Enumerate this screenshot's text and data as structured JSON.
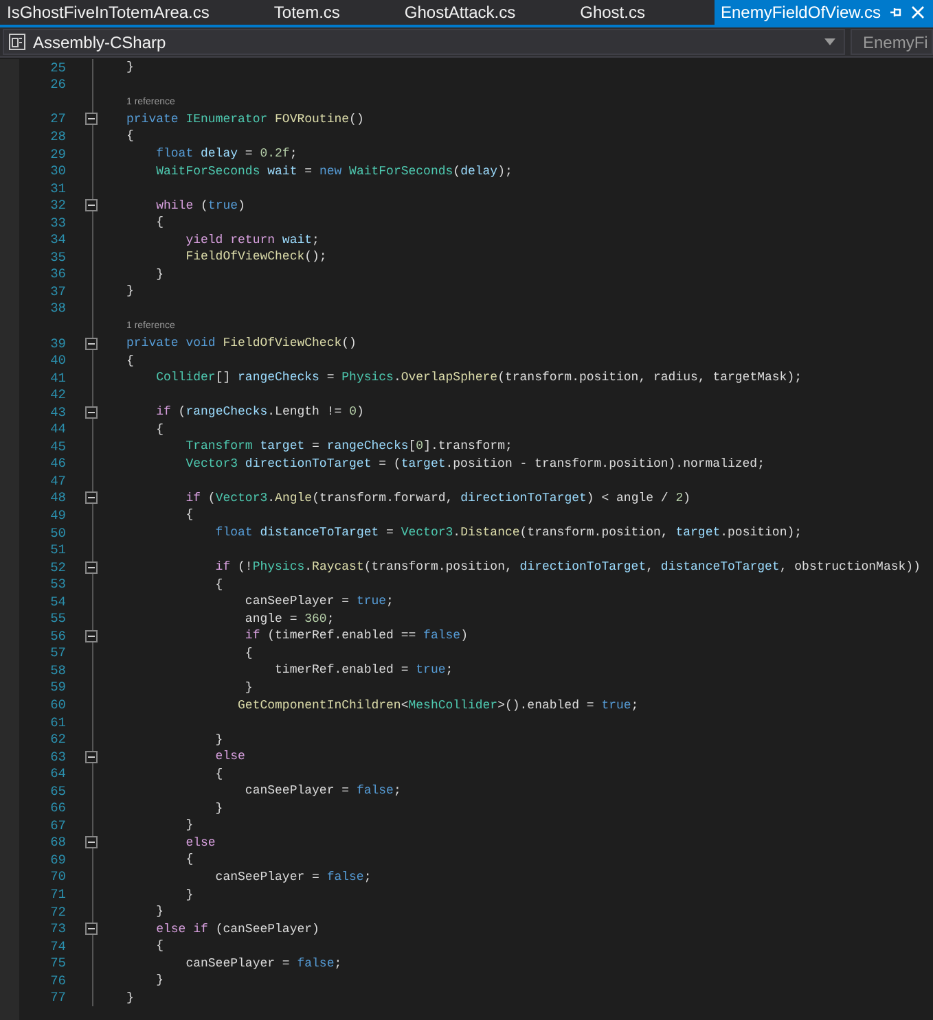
{
  "tabs": [
    {
      "label": "IsGhostFiveInTotemArea.cs",
      "selected": false
    },
    {
      "label": "Totem.cs",
      "selected": false
    },
    {
      "label": "GhostAttack.cs",
      "selected": false
    },
    {
      "label": "Ghost.cs",
      "selected": false
    },
    {
      "label": "EnemyFieldOfView.cs",
      "selected": true
    }
  ],
  "navigation_bar": {
    "project": "Assembly-CSharp",
    "class": "EnemyFi"
  },
  "lines": [
    {
      "kind": "code",
      "number": "25",
      "collapsible": false,
      "tokens": [
        {
          "kind": "plain",
          "text": "}"
        }
      ]
    },
    {
      "kind": "code",
      "number": "26",
      "collapsible": false
    },
    {
      "kind": "codelens",
      "text": "1 reference"
    },
    {
      "kind": "code",
      "number": "27",
      "collapsible": true,
      "tokens": [
        {
          "kind": "keyword",
          "text": "private"
        },
        {
          "kind": "type",
          "text": " IEnumerator"
        },
        {
          "kind": "method",
          "text": " FOVRoutine"
        },
        {
          "kind": "plain",
          "text": "()"
        }
      ]
    },
    {
      "kind": "code",
      "number": "28",
      "collapsible": false,
      "tokens": [
        {
          "kind": "plain",
          "text": "{"
        }
      ]
    },
    {
      "kind": "code",
      "number": "29",
      "collapsible": false,
      "tokens": [
        {
          "kind": "keyword",
          "text": "    float"
        },
        {
          "kind": "local",
          "text": " delay"
        },
        {
          "kind": "plain",
          "text": " = "
        },
        {
          "kind": "number",
          "text": "0.2f"
        },
        {
          "kind": "plain",
          "text": ";"
        }
      ]
    },
    {
      "kind": "code",
      "number": "30",
      "collapsible": false,
      "tokens": [
        {
          "kind": "type",
          "text": "    WaitForSeconds"
        },
        {
          "kind": "local",
          "text": " wait"
        },
        {
          "kind": "plain",
          "text": " = "
        },
        {
          "kind": "keyword",
          "text": "new"
        },
        {
          "kind": "type",
          "text": " WaitForSeconds"
        },
        {
          "kind": "plain",
          "text": "("
        },
        {
          "kind": "local",
          "text": "delay"
        },
        {
          "kind": "plain",
          "text": ");"
        }
      ]
    },
    {
      "kind": "code",
      "number": "31",
      "collapsible": false
    },
    {
      "kind": "code",
      "number": "32",
      "collapsible": true,
      "tokens": [
        {
          "kind": "control",
          "text": "    while"
        },
        {
          "kind": "plain",
          "text": " ("
        },
        {
          "kind": "keyword",
          "text": "true"
        },
        {
          "kind": "plain",
          "text": ")"
        }
      ]
    },
    {
      "kind": "code",
      "number": "33",
      "collapsible": false,
      "tokens": [
        {
          "kind": "plain",
          "text": "    {"
        }
      ]
    },
    {
      "kind": "code",
      "number": "34",
      "collapsible": false,
      "tokens": [
        {
          "kind": "control",
          "text": "        yield return"
        },
        {
          "kind": "local",
          "text": " wait"
        },
        {
          "kind": "plain",
          "text": ";"
        }
      ]
    },
    {
      "kind": "code",
      "number": "35",
      "collapsible": false,
      "tokens": [
        {
          "kind": "method",
          "text": "        FieldOfViewCheck"
        },
        {
          "kind": "plain",
          "text": "();"
        }
      ]
    },
    {
      "kind": "code",
      "number": "36",
      "collapsible": false,
      "tokens": [
        {
          "kind": "plain",
          "text": "    }"
        }
      ]
    },
    {
      "kind": "code",
      "number": "37",
      "collapsible": false,
      "tokens": [
        {
          "kind": "plain",
          "text": "}"
        }
      ]
    },
    {
      "kind": "code",
      "number": "38",
      "collapsible": false
    },
    {
      "kind": "codelens",
      "text": "1 reference"
    },
    {
      "kind": "code",
      "number": "39",
      "collapsible": true,
      "tokens": [
        {
          "kind": "keyword",
          "text": "private void"
        },
        {
          "kind": "method",
          "text": " FieldOfViewCheck"
        },
        {
          "kind": "plain",
          "text": "()"
        }
      ]
    },
    {
      "kind": "code",
      "number": "40",
      "collapsible": false,
      "tokens": [
        {
          "kind": "plain",
          "text": "{"
        }
      ]
    },
    {
      "kind": "code",
      "number": "41",
      "collapsible": false,
      "tokens": [
        {
          "kind": "type",
          "text": "    Collider"
        },
        {
          "kind": "plain",
          "text": "[] "
        },
        {
          "kind": "local",
          "text": "rangeChecks"
        },
        {
          "kind": "plain",
          "text": " = "
        },
        {
          "kind": "type",
          "text": "Physics"
        },
        {
          "kind": "plain",
          "text": "."
        },
        {
          "kind": "method",
          "text": "OverlapSphere"
        },
        {
          "kind": "plain",
          "text": "(transform.position, radius, targetMask);"
        }
      ]
    },
    {
      "kind": "code",
      "number": "42",
      "collapsible": false
    },
    {
      "kind": "code",
      "number": "43",
      "collapsible": true,
      "tokens": [
        {
          "kind": "control",
          "text": "    if"
        },
        {
          "kind": "plain",
          "text": " ("
        },
        {
          "kind": "local",
          "text": "rangeChecks"
        },
        {
          "kind": "plain",
          "text": ".Length != "
        },
        {
          "kind": "number",
          "text": "0"
        },
        {
          "kind": "plain",
          "text": ")"
        }
      ]
    },
    {
      "kind": "code",
      "number": "44",
      "collapsible": false,
      "tokens": [
        {
          "kind": "plain",
          "text": "    {"
        }
      ]
    },
    {
      "kind": "code",
      "number": "45",
      "collapsible": false,
      "tokens": [
        {
          "kind": "type",
          "text": "        Transform"
        },
        {
          "kind": "local",
          "text": " target"
        },
        {
          "kind": "plain",
          "text": " = "
        },
        {
          "kind": "local",
          "text": "rangeChecks"
        },
        {
          "kind": "plain",
          "text": "["
        },
        {
          "kind": "number",
          "text": "0"
        },
        {
          "kind": "plain",
          "text": "].transform;"
        }
      ]
    },
    {
      "kind": "code",
      "number": "46",
      "collapsible": false,
      "tokens": [
        {
          "kind": "type",
          "text": "        Vector3"
        },
        {
          "kind": "local",
          "text": " directionToTarget"
        },
        {
          "kind": "plain",
          "text": " = ("
        },
        {
          "kind": "local",
          "text": "target"
        },
        {
          "kind": "plain",
          "text": ".position - transform.position).normalized;"
        }
      ]
    },
    {
      "kind": "code",
      "number": "47",
      "collapsible": false
    },
    {
      "kind": "code",
      "number": "48",
      "collapsible": true,
      "tokens": [
        {
          "kind": "control",
          "text": "        if"
        },
        {
          "kind": "plain",
          "text": " ("
        },
        {
          "kind": "type",
          "text": "Vector3"
        },
        {
          "kind": "plain",
          "text": "."
        },
        {
          "kind": "method",
          "text": "Angle"
        },
        {
          "kind": "plain",
          "text": "(transform.forward, "
        },
        {
          "kind": "local",
          "text": "directionToTarget"
        },
        {
          "kind": "plain",
          "text": ") < angle / "
        },
        {
          "kind": "number",
          "text": "2"
        },
        {
          "kind": "plain",
          "text": ")"
        }
      ]
    },
    {
      "kind": "code",
      "number": "49",
      "collapsible": false,
      "tokens": [
        {
          "kind": "plain",
          "text": "        {"
        }
      ]
    },
    {
      "kind": "code",
      "number": "50",
      "collapsible": false,
      "tokens": [
        {
          "kind": "keyword",
          "text": "            float"
        },
        {
          "kind": "local",
          "text": " distanceToTarget"
        },
        {
          "kind": "plain",
          "text": " = "
        },
        {
          "kind": "type",
          "text": "Vector3"
        },
        {
          "kind": "plain",
          "text": "."
        },
        {
          "kind": "method",
          "text": "Distance"
        },
        {
          "kind": "plain",
          "text": "(transform.position, "
        },
        {
          "kind": "local",
          "text": "target"
        },
        {
          "kind": "plain",
          "text": ".position);"
        }
      ]
    },
    {
      "kind": "code",
      "number": "51",
      "collapsible": false
    },
    {
      "kind": "code",
      "number": "52",
      "collapsible": true,
      "tokens": [
        {
          "kind": "control",
          "text": "            if"
        },
        {
          "kind": "plain",
          "text": " (!"
        },
        {
          "kind": "type",
          "text": "Physics"
        },
        {
          "kind": "plain",
          "text": "."
        },
        {
          "kind": "method",
          "text": "Raycast"
        },
        {
          "kind": "plain",
          "text": "(transform.position, "
        },
        {
          "kind": "local",
          "text": "directionToTarget"
        },
        {
          "kind": "plain",
          "text": ", "
        },
        {
          "kind": "local",
          "text": "distanceToTarget"
        },
        {
          "kind": "plain",
          "text": ", obstructionMask))"
        }
      ]
    },
    {
      "kind": "code",
      "number": "53",
      "collapsible": false,
      "tokens": [
        {
          "kind": "plain",
          "text": "            {"
        }
      ]
    },
    {
      "kind": "code",
      "number": "54",
      "collapsible": false,
      "tokens": [
        {
          "kind": "plain",
          "text": "                canSeePlayer = "
        },
        {
          "kind": "keyword",
          "text": "true"
        },
        {
          "kind": "plain",
          "text": ";"
        }
      ]
    },
    {
      "kind": "code",
      "number": "55",
      "collapsible": false,
      "tokens": [
        {
          "kind": "plain",
          "text": "                angle = "
        },
        {
          "kind": "number",
          "text": "360"
        },
        {
          "kind": "plain",
          "text": ";"
        }
      ]
    },
    {
      "kind": "code",
      "number": "56",
      "collapsible": true,
      "tokens": [
        {
          "kind": "control",
          "text": "                if"
        },
        {
          "kind": "plain",
          "text": " (timerRef.enabled == "
        },
        {
          "kind": "keyword",
          "text": "false"
        },
        {
          "kind": "plain",
          "text": ")"
        }
      ]
    },
    {
      "kind": "code",
      "number": "57",
      "collapsible": false,
      "tokens": [
        {
          "kind": "plain",
          "text": "                {"
        }
      ]
    },
    {
      "kind": "code",
      "number": "58",
      "collapsible": false,
      "tokens": [
        {
          "kind": "plain",
          "text": "                    timerRef.enabled = "
        },
        {
          "kind": "keyword",
          "text": "true"
        },
        {
          "kind": "plain",
          "text": ";"
        }
      ]
    },
    {
      "kind": "code",
      "number": "59",
      "collapsible": false,
      "tokens": [
        {
          "kind": "plain",
          "text": "                }"
        }
      ]
    },
    {
      "kind": "code",
      "number": "60",
      "collapsible": false,
      "tokens": [
        {
          "kind": "method",
          "text": "               GetComponentInChildren"
        },
        {
          "kind": "plain",
          "text": "<"
        },
        {
          "kind": "type",
          "text": "MeshCollider"
        },
        {
          "kind": "plain",
          "text": ">().enabled = "
        },
        {
          "kind": "keyword",
          "text": "true"
        },
        {
          "kind": "plain",
          "text": ";"
        }
      ]
    },
    {
      "kind": "code",
      "number": "61",
      "collapsible": false
    },
    {
      "kind": "code",
      "number": "62",
      "collapsible": false,
      "tokens": [
        {
          "kind": "plain",
          "text": "            }"
        }
      ]
    },
    {
      "kind": "code",
      "number": "63",
      "collapsible": true,
      "tokens": [
        {
          "kind": "control",
          "text": "            else"
        }
      ]
    },
    {
      "kind": "code",
      "number": "64",
      "collapsible": false,
      "tokens": [
        {
          "kind": "plain",
          "text": "            {"
        }
      ]
    },
    {
      "kind": "code",
      "number": "65",
      "collapsible": false,
      "tokens": [
        {
          "kind": "plain",
          "text": "                canSeePlayer = "
        },
        {
          "kind": "keyword",
          "text": "false"
        },
        {
          "kind": "plain",
          "text": ";"
        }
      ]
    },
    {
      "kind": "code",
      "number": "66",
      "collapsible": false,
      "tokens": [
        {
          "kind": "plain",
          "text": "            }"
        }
      ]
    },
    {
      "kind": "code",
      "number": "67",
      "collapsible": false,
      "tokens": [
        {
          "kind": "plain",
          "text": "        }"
        }
      ]
    },
    {
      "kind": "code",
      "number": "68",
      "collapsible": true,
      "tokens": [
        {
          "kind": "control",
          "text": "        else"
        }
      ]
    },
    {
      "kind": "code",
      "number": "69",
      "collapsible": false,
      "tokens": [
        {
          "kind": "plain",
          "text": "        {"
        }
      ]
    },
    {
      "kind": "code",
      "number": "70",
      "collapsible": false,
      "tokens": [
        {
          "kind": "plain",
          "text": "            canSeePlayer = "
        },
        {
          "kind": "keyword",
          "text": "false"
        },
        {
          "kind": "plain",
          "text": ";"
        }
      ]
    },
    {
      "kind": "code",
      "number": "71",
      "collapsible": false,
      "tokens": [
        {
          "kind": "plain",
          "text": "        }"
        }
      ]
    },
    {
      "kind": "code",
      "number": "72",
      "collapsible": false,
      "tokens": [
        {
          "kind": "plain",
          "text": "    }"
        }
      ]
    },
    {
      "kind": "code",
      "number": "73",
      "collapsible": true,
      "tokens": [
        {
          "kind": "control",
          "text": "    else if"
        },
        {
          "kind": "plain",
          "text": " (canSeePlayer)"
        }
      ]
    },
    {
      "kind": "code",
      "number": "74",
      "collapsible": false,
      "tokens": [
        {
          "kind": "plain",
          "text": "    {"
        }
      ]
    },
    {
      "kind": "code",
      "number": "75",
      "collapsible": false,
      "tokens": [
        {
          "kind": "plain",
          "text": "        canSeePlayer = "
        },
        {
          "kind": "keyword",
          "text": "false"
        },
        {
          "kind": "plain",
          "text": ";"
        }
      ]
    },
    {
      "kind": "code",
      "number": "76",
      "collapsible": false,
      "tokens": [
        {
          "kind": "plain",
          "text": "    }"
        }
      ]
    },
    {
      "kind": "code",
      "number": "77",
      "collapsible": false,
      "tokens": [
        {
          "kind": "plain",
          "text": "}"
        }
      ]
    }
  ]
}
